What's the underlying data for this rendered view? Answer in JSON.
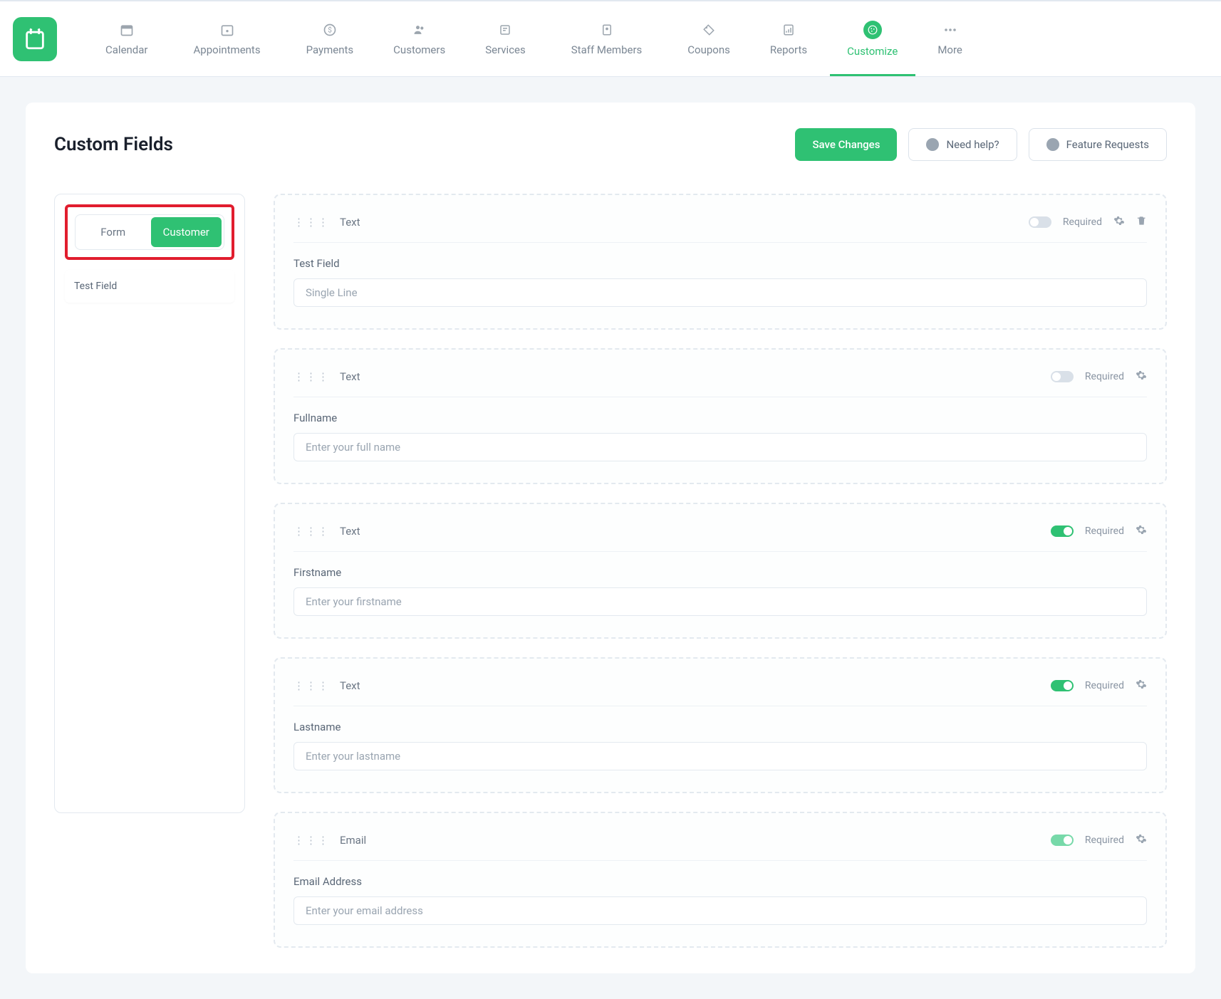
{
  "nav": {
    "items": [
      {
        "label": "Calendar"
      },
      {
        "label": "Appointments"
      },
      {
        "label": "Payments"
      },
      {
        "label": "Customers"
      },
      {
        "label": "Services"
      },
      {
        "label": "Staff Members"
      },
      {
        "label": "Coupons"
      },
      {
        "label": "Reports"
      },
      {
        "label": "Customize"
      },
      {
        "label": "More"
      }
    ]
  },
  "page": {
    "title": "Custom Fields"
  },
  "actions": {
    "save": "Save Changes",
    "help": "Need help?",
    "features": "Feature Requests"
  },
  "sidebar": {
    "tabs": {
      "form": "Form",
      "customer": "Customer"
    },
    "items": [
      {
        "label": "Test Field"
      }
    ]
  },
  "labels": {
    "required": "Required"
  },
  "fields": [
    {
      "type": "Text",
      "label": "Test Field",
      "placeholder": "Single Line",
      "required": false,
      "deletable": true,
      "toggleLight": false
    },
    {
      "type": "Text",
      "label": "Fullname",
      "placeholder": "Enter your full name",
      "required": false,
      "deletable": false,
      "toggleLight": false
    },
    {
      "type": "Text",
      "label": "Firstname",
      "placeholder": "Enter your firstname",
      "required": true,
      "deletable": false,
      "toggleLight": false
    },
    {
      "type": "Text",
      "label": "Lastname",
      "placeholder": "Enter your lastname",
      "required": true,
      "deletable": false,
      "toggleLight": false
    },
    {
      "type": "Email",
      "label": "Email Address",
      "placeholder": "Enter your email address",
      "required": true,
      "deletable": false,
      "toggleLight": true
    }
  ]
}
